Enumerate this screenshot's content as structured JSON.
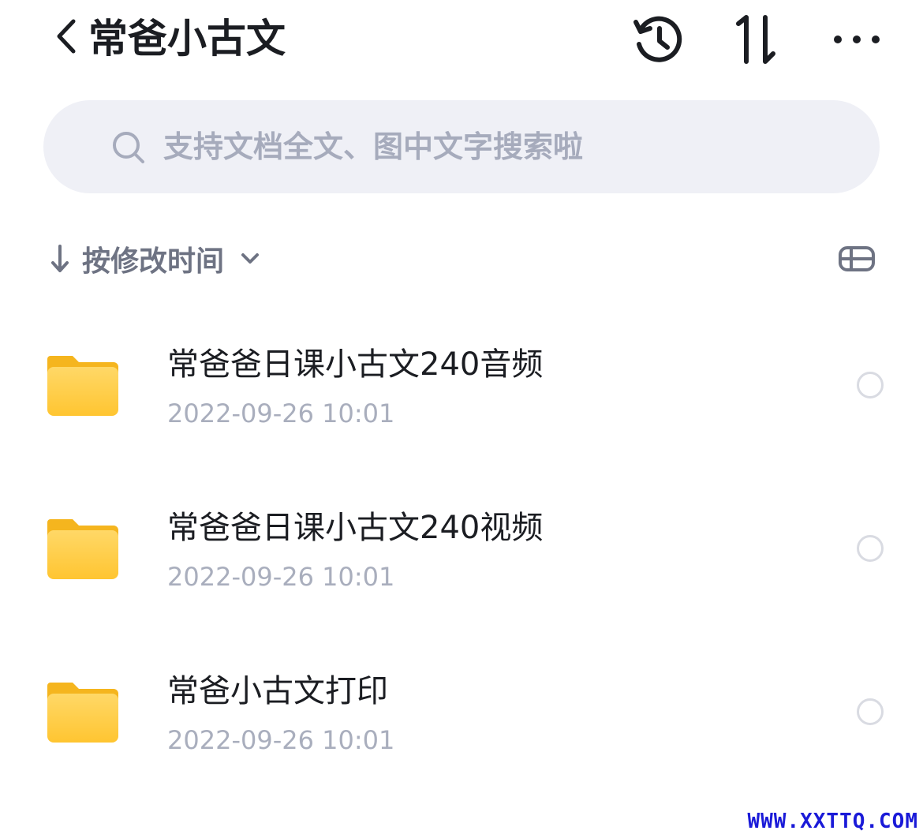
{
  "header": {
    "title": "常爸小古文",
    "icons": [
      "chevron-left-icon",
      "history-icon",
      "sort-icon",
      "more-icon"
    ]
  },
  "search": {
    "placeholder": "支持文档全文、图中文字搜索啦",
    "value": ""
  },
  "sort": {
    "label": "按修改时间",
    "direction": "descending"
  },
  "colors": {
    "accent_folder": "#ffc83d",
    "text_primary": "#1b1d22",
    "text_secondary": "#a9aebd",
    "search_bg": "#eff0f6"
  },
  "files": [
    {
      "name": "常爸爸日课小古文240音频",
      "modified": "2022-09-26 10:01"
    },
    {
      "name": "常爸爸日课小古文240视频",
      "modified": "2022-09-26 10:01"
    },
    {
      "name": "常爸小古文打印",
      "modified": "2022-09-26 10:01"
    }
  ],
  "watermark": "WWW.XXTTQ.COM"
}
